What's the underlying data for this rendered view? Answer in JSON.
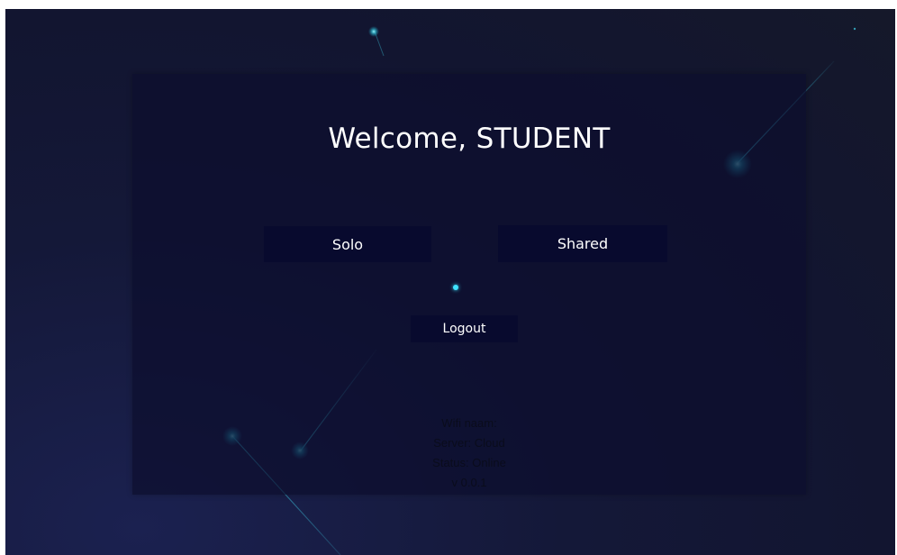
{
  "welcome": {
    "title": "Welcome, STUDENT"
  },
  "modes": {
    "solo_label": "Solo",
    "shared_label": "Shared"
  },
  "account": {
    "logout_label": "Logout"
  },
  "status_info": {
    "wifi": "Wifi naam:",
    "server": "Server: Cloud",
    "status": "Status: Online",
    "version": "v 0.0.1"
  },
  "colors": {
    "background": "#141838",
    "panel": "#0c0e2e",
    "button": "#080a2e",
    "accent": "#3fe3ff",
    "text": "#ffffff"
  },
  "icons": {
    "loading_indicator": "loading-dot-icon",
    "decoration": "shooting-star-icon"
  }
}
